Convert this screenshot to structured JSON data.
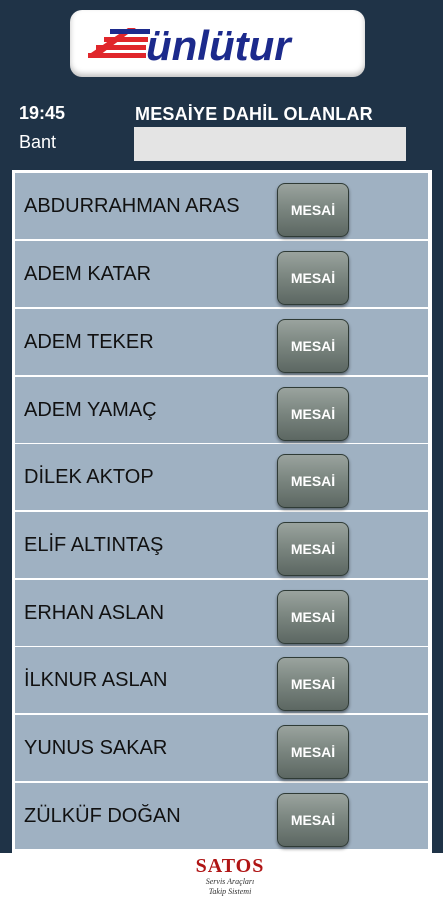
{
  "header": {
    "logo_text": "ünlütur",
    "time": "19:45",
    "bant_label": "Bant",
    "title": "MESAİYE DAHİL OLANLAR",
    "input_value": ""
  },
  "list": {
    "button_label": "MESAİ",
    "rows": [
      {
        "name": "ABDURRAHMAN ARAS"
      },
      {
        "name": "ADEM KATAR"
      },
      {
        "name": "ADEM TEKER"
      },
      {
        "name": "ADEM YAMAÇ"
      },
      {
        "name": "DİLEK AKTOP"
      },
      {
        "name": "ELİF ALTINTAŞ"
      },
      {
        "name": "ERHAN ASLAN"
      },
      {
        "name": "İLKNUR ASLAN"
      },
      {
        "name": "YUNUS SAKAR"
      },
      {
        "name": "ZÜLKÜF DOĞAN"
      }
    ]
  },
  "footer": {
    "brand": "SATOS",
    "tagline_1": "Servis Araçları",
    "tagline_2": "Takip Sistemi"
  },
  "colors": {
    "background": "#1f3347",
    "row": "#9fb1c2",
    "logo_red": "#e0262b",
    "logo_blue": "#1c2a8c"
  }
}
